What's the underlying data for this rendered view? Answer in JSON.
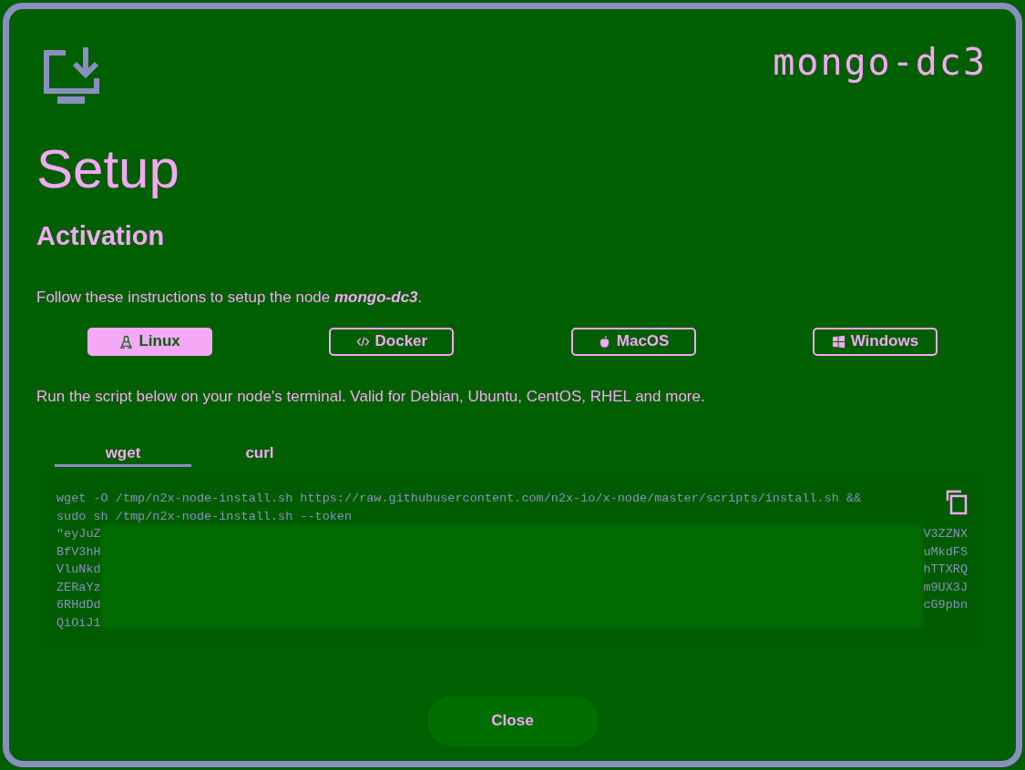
{
  "node_name": "mongo-dc3",
  "title": "Setup",
  "section": "Activation",
  "intro": "Follow these instructions to setup the node **mongo-dc3**.",
  "platforms": [
    {
      "label": "Linux",
      "kind": "linux",
      "selected": true
    },
    {
      "label": "Docker",
      "kind": "docker",
      "selected": false
    },
    {
      "label": "MacOS",
      "kind": "macos",
      "selected": false
    },
    {
      "label": "Windows",
      "kind": "windows",
      "selected": false
    }
  ],
  "instructions": "Run the script below on your node's terminal. Valid for Debian, Ubuntu, CentOS, RHEL and more.",
  "tabs": [
    {
      "label": "wget",
      "selected": true
    },
    {
      "label": "curl",
      "selected": false
    }
  ],
  "code_lines": [
    "wget -O /tmp/n2x-node-install.sh https://raw.githubusercontent.com/n2x-io/x-node/master/scripts/install.sh &&",
    "sudo sh /tmp/n2x-node-install.sh --token"
  ],
  "token_lines": [
    {
      "start": "\"eyJuZ",
      "end": "V3ZZNX"
    },
    {
      "start": "BfV3hH",
      "end": "uMkdFS"
    },
    {
      "start": "VluNkd",
      "end": "hTTXRQ"
    },
    {
      "start": "ZERaYz",
      "end": "m9UX3J"
    },
    {
      "start": "6RHdDd",
      "end": "cG9pbn"
    },
    {
      "start": "QiOiJ1"
    }
  ],
  "close_button": "Close"
}
